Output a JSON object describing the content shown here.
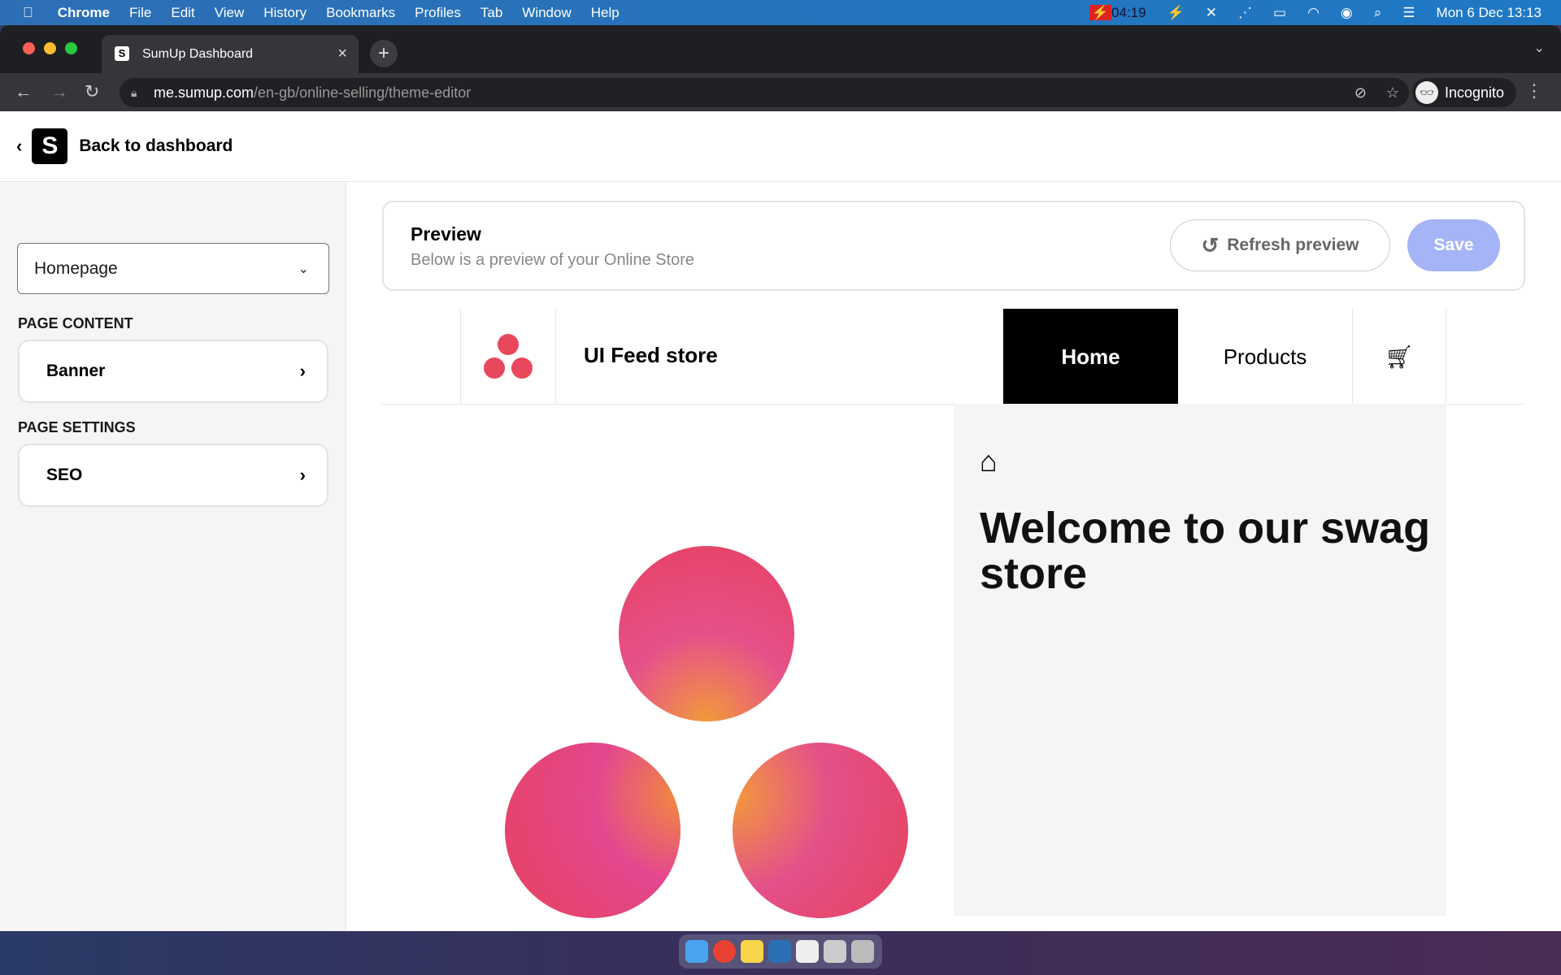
{
  "menubar": {
    "app": "Chrome",
    "items": [
      "File",
      "Edit",
      "View",
      "History",
      "Bookmarks",
      "Profiles",
      "Tab",
      "Window",
      "Help"
    ],
    "recording": "04:19",
    "datetime": "Mon 6 Dec  13:13"
  },
  "browser": {
    "tab_title": "SumUp Dashboard",
    "url_host": "me.sumup.com",
    "url_path": "/en-gb/online-selling/theme-editor",
    "profile": "Incognito"
  },
  "header": {
    "back_label": "Back to dashboard",
    "logo": "S"
  },
  "sidebar": {
    "page_select": "Homepage",
    "page_content_heading": "PAGE CONTENT",
    "page_content_items": [
      "Banner"
    ],
    "page_settings_heading": "PAGE SETTINGS",
    "page_settings_items": [
      "SEO"
    ]
  },
  "preview": {
    "title": "Preview",
    "subtitle": "Below is a preview of your Online Store",
    "refresh_label": "Refresh preview",
    "save_label": "Save"
  },
  "store": {
    "name": "UI Feed store",
    "nav": [
      "Home",
      "Products"
    ],
    "active": "Home",
    "hero_title": "Welcome to our swag store"
  },
  "colors": {
    "save": "#a5b4f6",
    "brand_circle": "#e8475c",
    "accent_orange": "#f2933a"
  }
}
